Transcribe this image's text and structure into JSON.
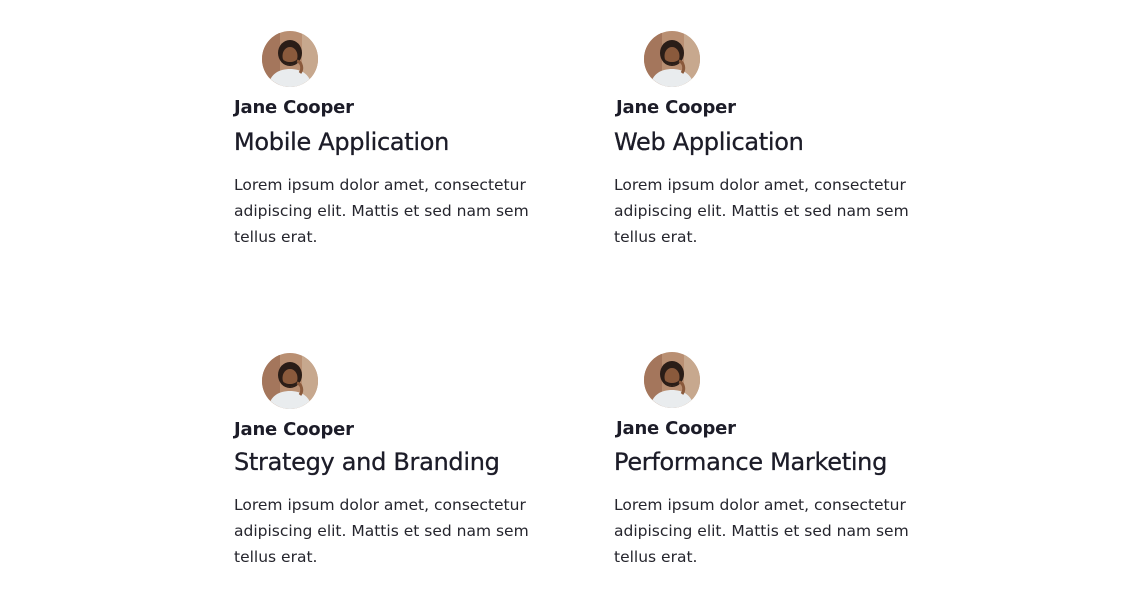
{
  "cards": [
    {
      "author": "Jane Cooper",
      "title": "Mobile Application",
      "description": "Lorem ipsum dolor amet, consectetur adipiscing elit. Mattis et sed nam sem tellus erat."
    },
    {
      "author": "Jane Cooper",
      "title": "Web Application",
      "description": "Lorem ipsum dolor amet, consectetur adipiscing elit. Mattis et sed nam sem tellus erat."
    },
    {
      "author": "Jane Cooper",
      "title": "Strategy and Branding",
      "description": "Lorem ipsum dolor amet, consectetur adipiscing elit. Mattis et sed nam sem tellus erat."
    },
    {
      "author": "Jane Cooper",
      "title": "Performance Marketing",
      "description": "Lorem ipsum dolor amet, consectetur adipiscing elit. Mattis et sed nam sem tellus erat."
    }
  ],
  "avatar_icon": "person-photo-icon"
}
